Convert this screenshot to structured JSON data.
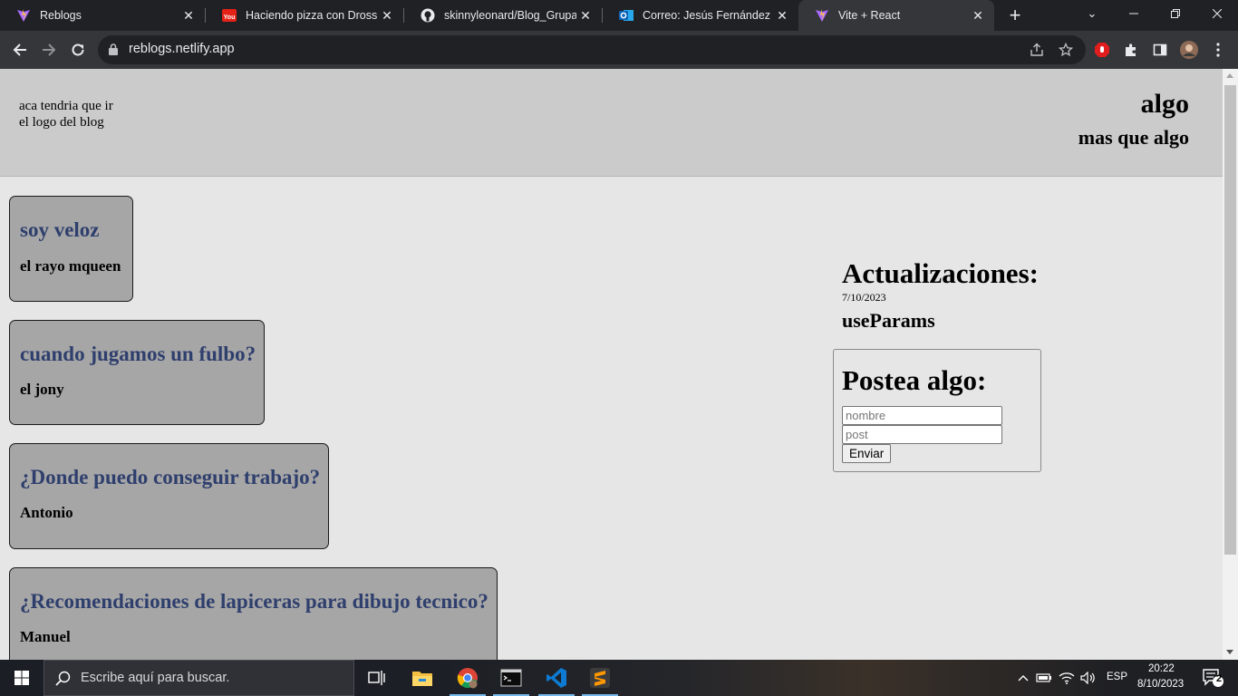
{
  "browser": {
    "tabs": [
      {
        "title": "Reblogs",
        "icon": "vite-icon",
        "active": false
      },
      {
        "title": "Haciendo pizza con Dross - Y",
        "icon": "youtube-icon",
        "active": false
      },
      {
        "title": "skinnyleonard/Blog_Grupal",
        "icon": "github-icon",
        "active": false
      },
      {
        "title": "Correo: Jesús Fernández - O",
        "icon": "outlook-icon",
        "active": false
      },
      {
        "title": "Vite + React",
        "icon": "vite-icon",
        "active": true
      }
    ],
    "url": "reblogs.netlify.app"
  },
  "header": {
    "logo_text": "aca tendria que ir el logo del blog",
    "title": "algo",
    "subtitle": "mas que algo"
  },
  "posts": [
    {
      "title": "soy veloz",
      "author": "el rayo mqueen"
    },
    {
      "title": "cuando jugamos un fulbo?",
      "author": "el jony"
    },
    {
      "title": "¿Donde puedo conseguir trabajo?",
      "author": "Antonio"
    },
    {
      "title": "¿Recomendaciones de lapiceras para dibujo tecnico?",
      "author": "Manuel"
    }
  ],
  "updates": {
    "title": "Actualizaciones:",
    "date": "7/10/2023",
    "item": "useParams"
  },
  "form": {
    "title": "Postea algo:",
    "name_placeholder": "nombre",
    "post_placeholder": "post",
    "submit_label": "Enviar"
  },
  "taskbar": {
    "search_placeholder": "Escribe aquí para buscar.",
    "language": "ESP",
    "time": "20:22",
    "date": "8/10/2023",
    "notifications": "2"
  },
  "colors": {
    "post_title": "#2f3f6d",
    "card_bg": "#a6a6a6",
    "header_bg": "#cbcbcb",
    "page_bg": "#e6e6e6"
  }
}
